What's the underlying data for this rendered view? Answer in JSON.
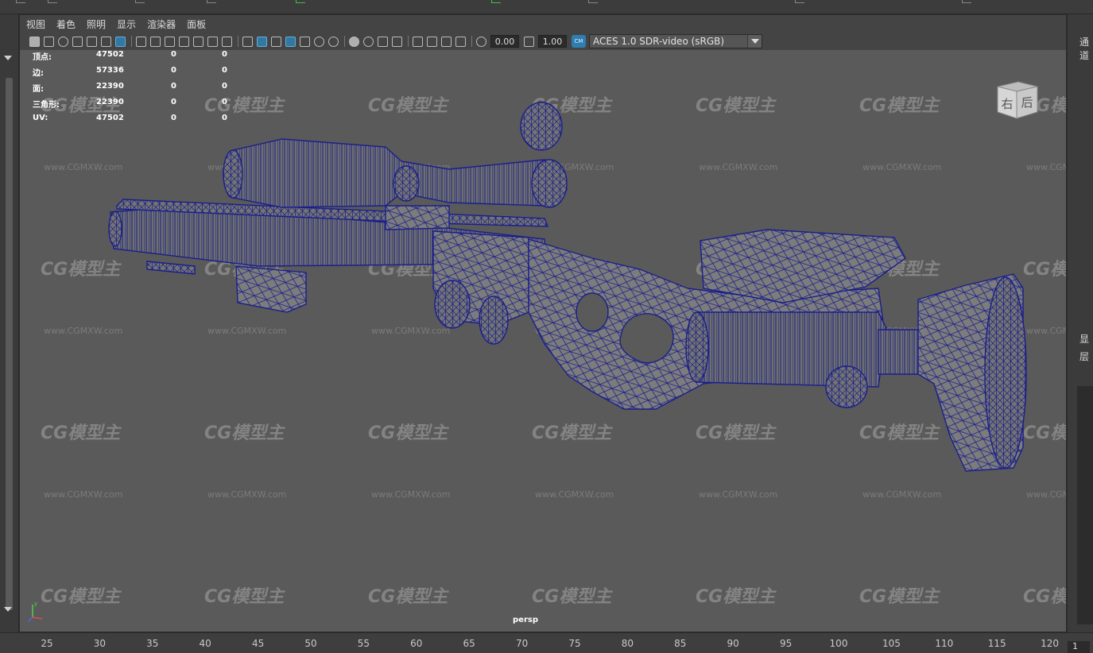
{
  "menu": [
    "视图",
    "着色",
    "照明",
    "显示",
    "渲染器",
    "面板"
  ],
  "toolbar": {
    "gamma_value": "0.00",
    "exposure_value": "1.00",
    "colorspace_badge": "CM",
    "colorspace": "ACES 1.0 SDR-video (sRGB)"
  },
  "hud": {
    "rows": [
      {
        "label": "顶点:",
        "v1": "47502",
        "v2": "0",
        "v3": "0"
      },
      {
        "label": "边:",
        "v1": "57336",
        "v2": "0",
        "v3": "0"
      },
      {
        "label": "面:",
        "v1": "22390",
        "v2": "0",
        "v3": "0"
      },
      {
        "label": "三角形:",
        "v1": "22390",
        "v2": "0",
        "v3": "0"
      },
      {
        "label": "UV:",
        "v1": "47502",
        "v2": "0",
        "v3": "0"
      }
    ]
  },
  "viewcube": {
    "face_right": "右",
    "face_back": "后"
  },
  "camera_label": "persp",
  "axis": {
    "x": "x",
    "y": "y",
    "z": "z"
  },
  "watermark": {
    "logo": "CG模型主",
    "url": "www.CGMXW.com"
  },
  "right_panel": {
    "tab_top": "通道",
    "label_display": "显",
    "label_layer": "层"
  },
  "timeline": {
    "ticks": [
      "25",
      "30",
      "35",
      "40",
      "45",
      "50",
      "55",
      "60",
      "65",
      "70",
      "75",
      "80",
      "85",
      "90",
      "95",
      "100",
      "105",
      "110",
      "115",
      "120"
    ],
    "current_frame": "1"
  },
  "colors": {
    "wireframe": "#1a1f8a",
    "viewport_bg": "#5a5a5a",
    "highlight": "#2e7fb0"
  },
  "icons": [
    "camera-icon",
    "grid-icon",
    "shaded-cube-icon",
    "wireframe-icon",
    "light-icon",
    "xray-icon",
    "isolate-icon",
    "resolution-gate-icon"
  ]
}
